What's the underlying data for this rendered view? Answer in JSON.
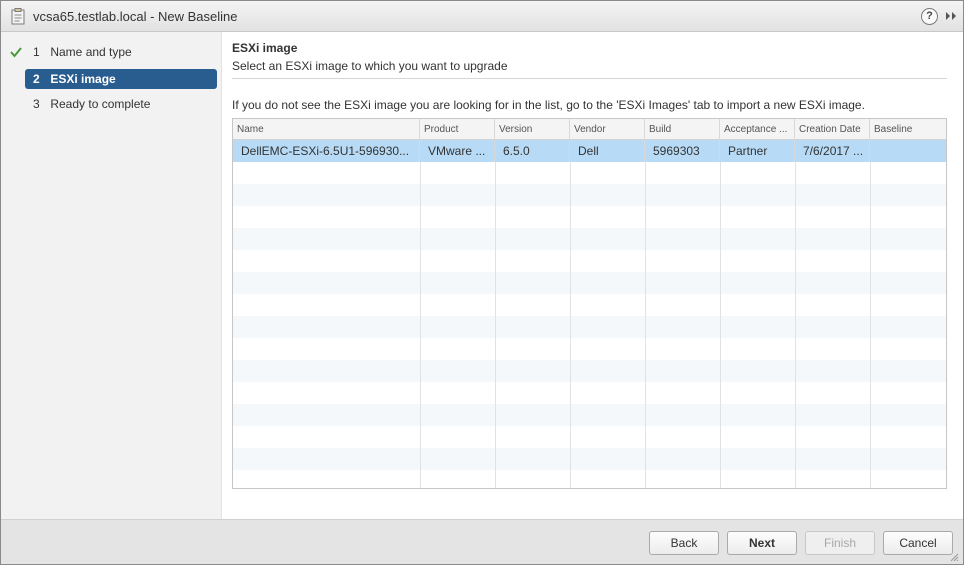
{
  "window": {
    "title": "vcsa65.testlab.local - New Baseline",
    "help_glyph": "?"
  },
  "nav": {
    "steps": [
      {
        "num": "1",
        "label": "Name and type",
        "state": "done"
      },
      {
        "num": "2",
        "label": "ESXi image",
        "state": "active"
      },
      {
        "num": "3",
        "label": "Ready to complete",
        "state": "pending"
      }
    ]
  },
  "main": {
    "title": "ESXi image",
    "subtitle": "Select an ESXi image to which you want to upgrade",
    "info": "If you do not see the ESXi image you are looking for in the list, go to the 'ESXi Images' tab to import a new ESXi image."
  },
  "table": {
    "columns": [
      "Name",
      "Product",
      "Version",
      "Vendor",
      "Build",
      "Acceptance ...",
      "Creation Date",
      "Baseline"
    ],
    "rows": [
      [
        "DellEMC-ESXi-6.5U1-596930...",
        "VMware ...",
        "6.5.0",
        "Dell",
        "5969303",
        "Partner",
        "7/6/2017 ...",
        ""
      ]
    ]
  },
  "footer": {
    "back": "Back",
    "next": "Next",
    "finish": "Finish",
    "cancel": "Cancel"
  },
  "colors": {
    "active_step": "#2a5d8f",
    "selected_row": "#b7dbf6",
    "check_green": "#4a9a3a"
  }
}
